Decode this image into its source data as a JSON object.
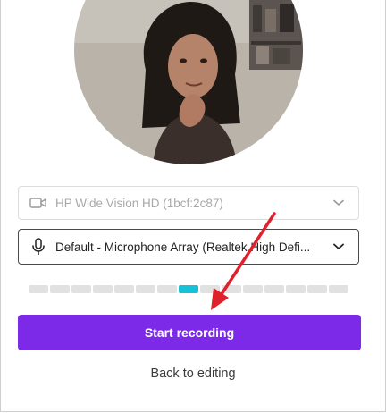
{
  "camera_select": {
    "value": "HP Wide Vision HD (1bcf:2c87)",
    "icon": "video-camera-icon",
    "disabled": true
  },
  "mic_select": {
    "value": "Default - Microphone Array (Realtek High Defi...",
    "icon": "microphone-icon"
  },
  "audio_meter": {
    "segments": 15,
    "active_segment": 8,
    "active_color": "#18c2d6",
    "inactive_color": "#e1e1e1"
  },
  "buttons": {
    "start_recording": "Start recording",
    "back_to_editing": "Back to editing"
  },
  "colors": {
    "primary": "#7d2ae8",
    "annotation_arrow": "#e0202a"
  }
}
